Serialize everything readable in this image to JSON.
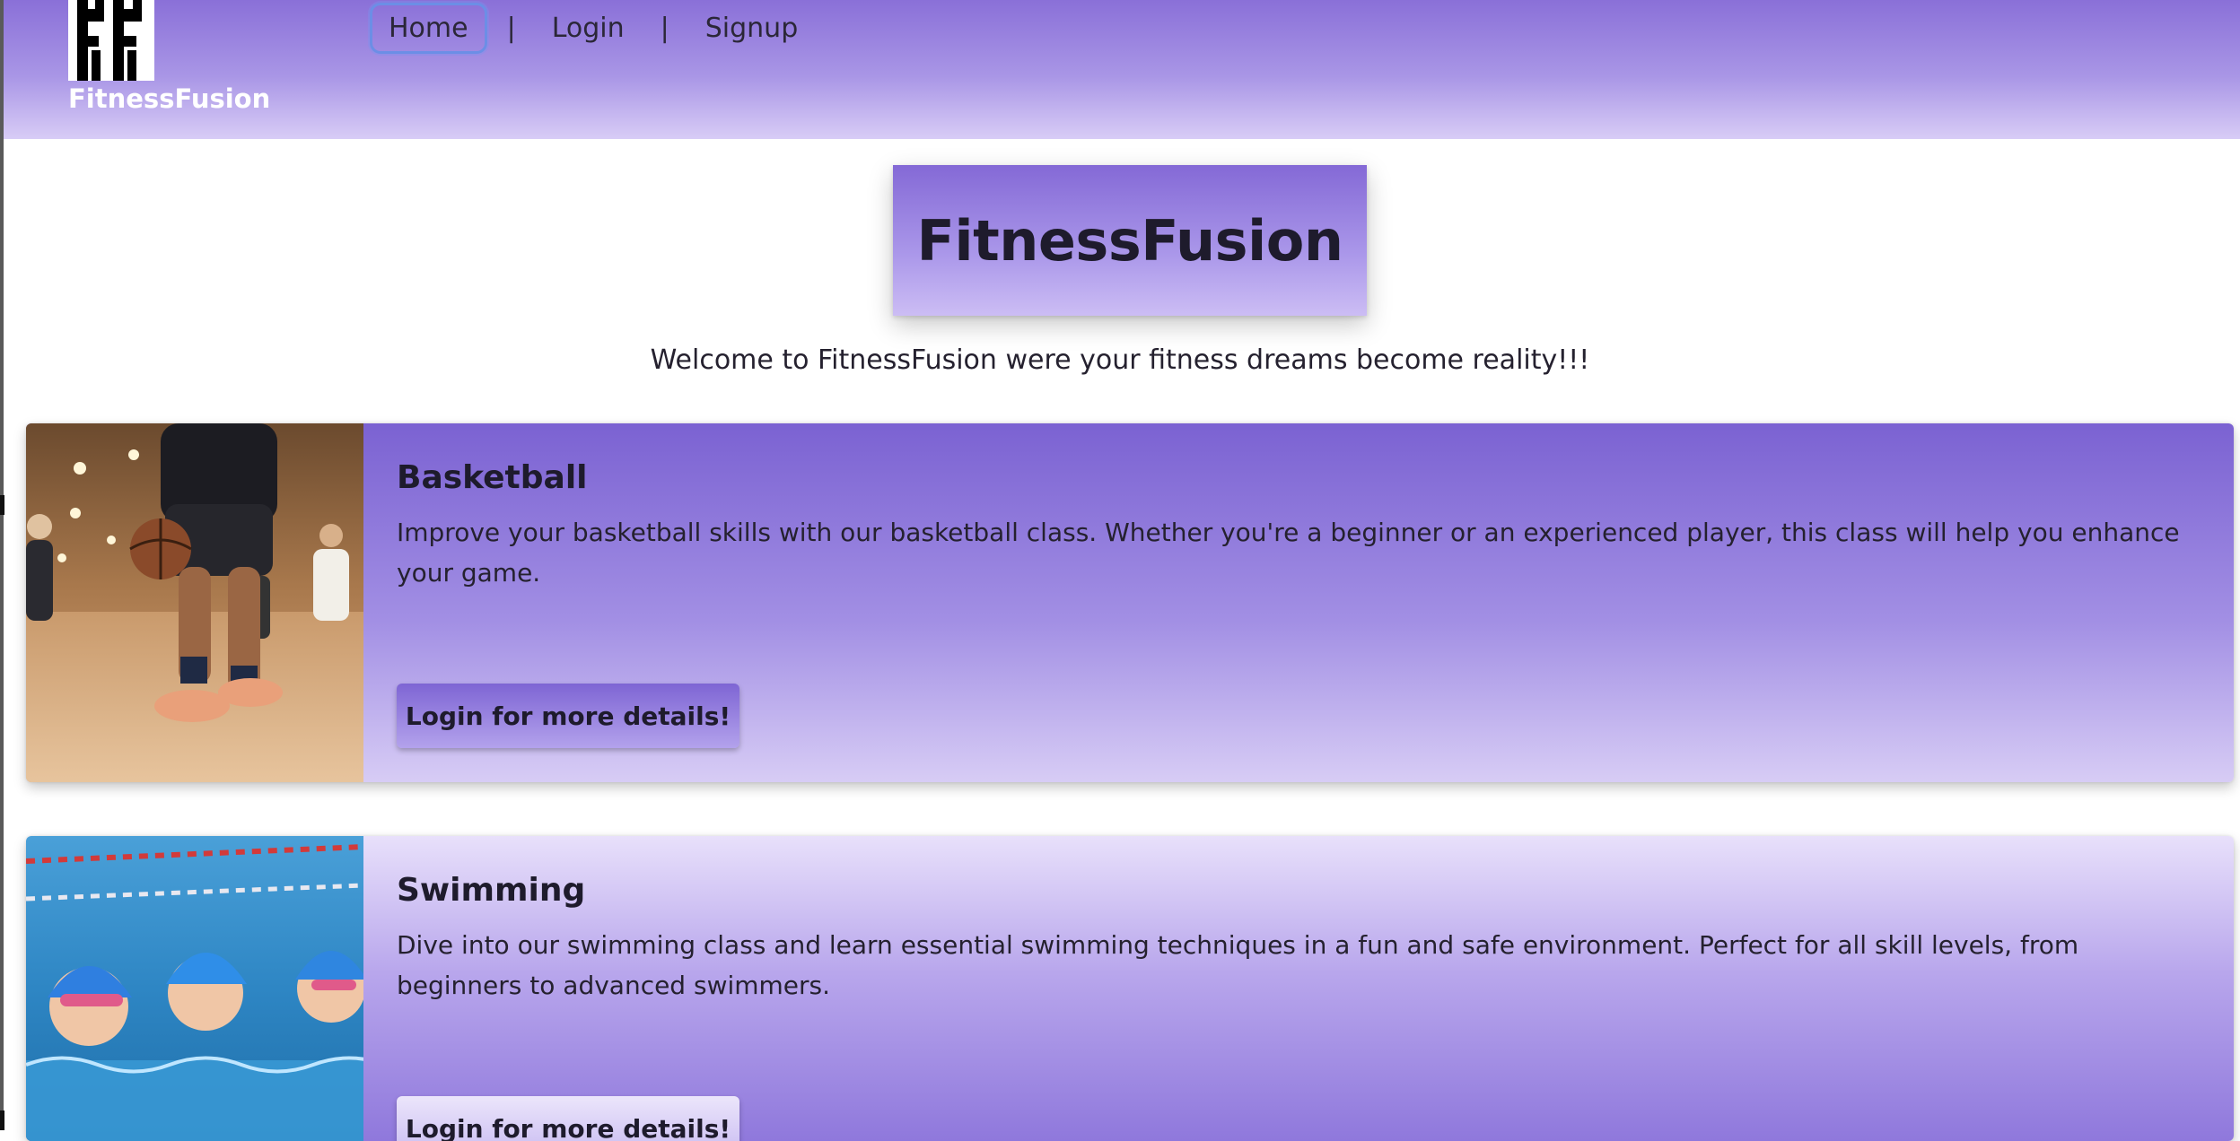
{
  "brand": {
    "name": "FitnessFusion",
    "logo_glyph": "FF"
  },
  "nav": {
    "home": "Home",
    "separator_1": "|",
    "login": "Login",
    "separator_2": "|",
    "signup": "Signup",
    "active": "home"
  },
  "hero": {
    "title": "FitnessFusion",
    "welcome": "Welcome to FitnessFusion were your fitness dreams become reality!!!"
  },
  "classes": [
    {
      "title": "Basketball",
      "description": "Improve your basketball skills with our basketball class. Whether you're a beginner or an experienced player, this class will help you enhance your game.",
      "button": "Login for more details!",
      "image": "basketball-photo"
    },
    {
      "title": "Swimming",
      "description": "Dive into our swimming class and learn essential swimming techniques in a fun and safe environment. Perfect for all skill levels, from beginners to advanced swimmers.",
      "button": "Login for more details!",
      "image": "swimming-photo"
    }
  ],
  "colors": {
    "accent": "#8a70d8",
    "accent_light": "#d8ccf6",
    "text": "#1e1b2c"
  }
}
